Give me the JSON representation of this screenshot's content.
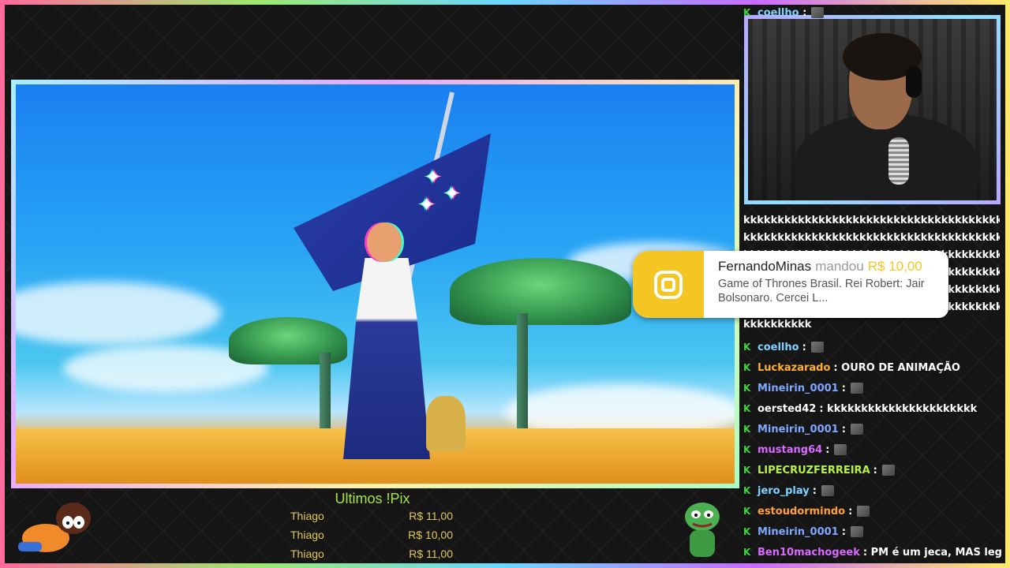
{
  "alert": {
    "user": "FernandoMinas",
    "verb": "mandou",
    "amount": "R$ 10,00",
    "message": "Game of Thrones Brasil. Rei Robert: Jair Bolsonaro. Cercei L..."
  },
  "pix": {
    "title": "Ultimos !Pix",
    "entries": [
      {
        "name": "Thiago",
        "amount": "R$ 11,00"
      },
      {
        "name": "Thiago",
        "amount": "R$ 10,00"
      },
      {
        "name": "Thiago",
        "amount": "R$ 11,00"
      }
    ]
  },
  "chat": {
    "top_user": "coellho",
    "spam_lines": [
      "kkkkkkkkkkkkkkkkkkkkkkkkkkkkkkkkkkkkkkkkkk",
      "kkkkkkkkkkkkkkkkkkkkkkkkkkkkkkkkkkkkkkkkkk",
      "kkkkkkkkkkkkkkkkkkkkkkkkkkkkkkkkkkkkkkkkkk",
      "kkkkkkkkkkkkkkkkkkkkkkkkkkkkkkkkkkkkkkkkkk",
      "kkkkkkkkkkkkkkkkkkkkkkkkkkkkkkkkkkkkkkkkkk",
      "kkkkkkkkkkkkkkkkkkkkkkkkkkkkkkkkkkkkkkkkkk",
      "kkkkkkkkkk"
    ],
    "messages": [
      {
        "user": "coellho",
        "color": "#7fd4ff",
        "text": ":",
        "emote": true
      },
      {
        "user": "Luckazarado",
        "color": "#ffb02e",
        "text": ": OURO DE ANIMAÇÃO",
        "emote": false
      },
      {
        "user": "Mineirin_0001",
        "color": "#7fa8ff",
        "text": ":",
        "emote": true
      },
      {
        "user": "oersted42",
        "color": "#ffffff",
        "text": ": kkkkkkkkkkkkkkkkkkkkkk",
        "emote": false
      },
      {
        "user": "Mineirin_0001",
        "color": "#7fa8ff",
        "text": ":",
        "emote": true
      },
      {
        "user": "mustang64",
        "color": "#d86bff",
        "text": ":",
        "emote": true
      },
      {
        "user": "LIPECRUZFERREIRA",
        "color": "#b8f04a",
        "text": ":",
        "emote": true
      },
      {
        "user": "jero_play",
        "color": "#7fd4ff",
        "text": ":",
        "emote": true
      },
      {
        "user": "estoudormindo",
        "color": "#ff9e3a",
        "text": ":",
        "emote": true
      },
      {
        "user": "Mineirin_0001",
        "color": "#7fa8ff",
        "text": ":",
        "emote": true
      },
      {
        "user": "Ben10machogeek",
        "color": "#d86bff",
        "text": ": PM é um jeca, MAS legal.",
        "emote": false
      }
    ]
  },
  "colors": {
    "chat_badge": "#3ad63a",
    "pix_title": "#a6e34a",
    "pix_row": "#e2c85a",
    "alert_accent": "#f3c623"
  },
  "icons": {
    "alert": "pix-logo-icon",
    "badge": "k-badge-icon"
  }
}
